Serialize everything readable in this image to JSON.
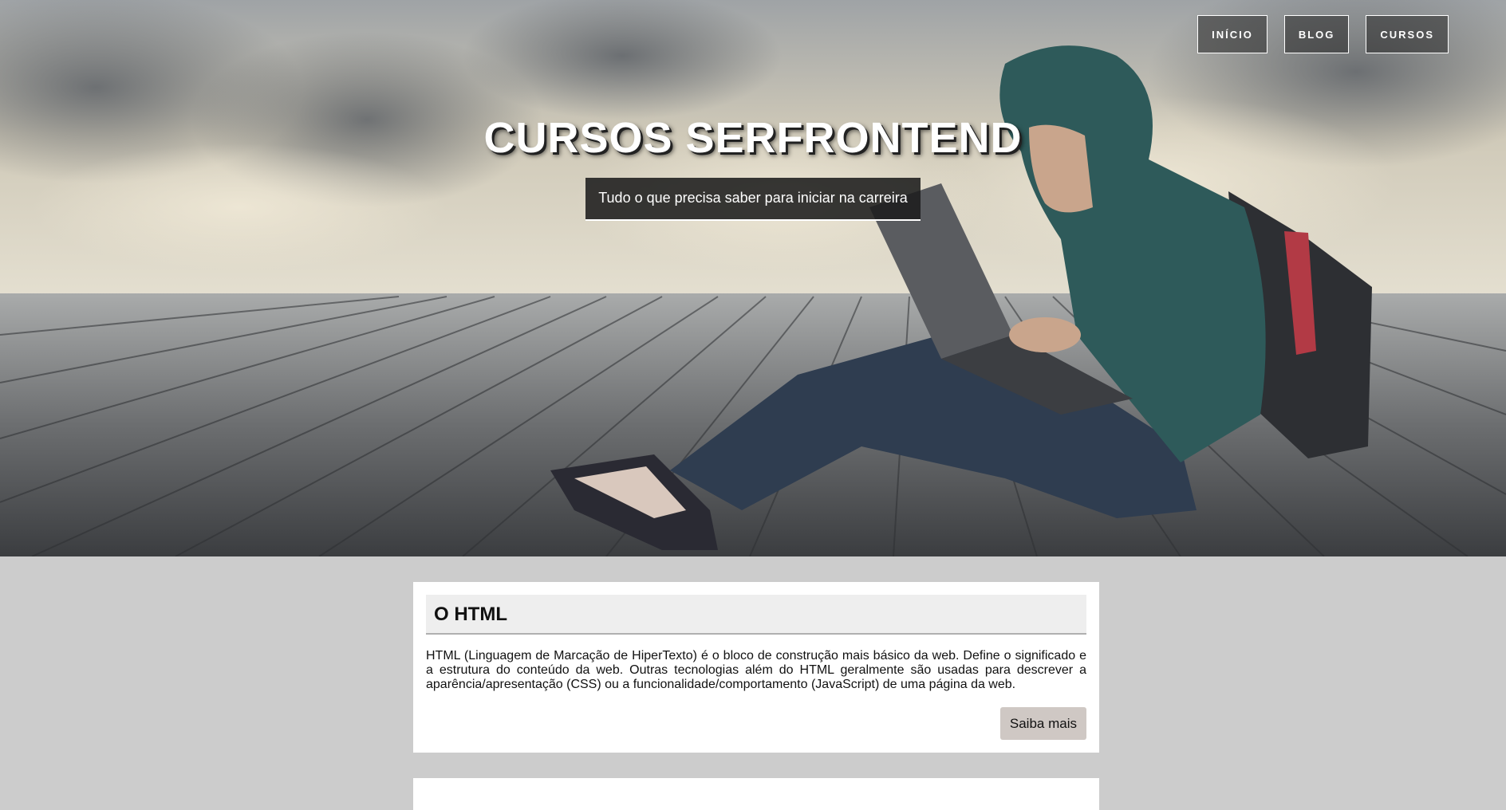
{
  "nav": {
    "items": [
      {
        "label": "INÍCIO"
      },
      {
        "label": "BLOG"
      },
      {
        "label": "CURSOS"
      }
    ]
  },
  "hero": {
    "title": "CURSOS SERFRONTEND",
    "subtitle": "Tudo o que precisa saber para iniciar na carreira",
    "image": "student-with-laptop-on-wooden-deck-photo"
  },
  "cards": [
    {
      "title": "O HTML",
      "text": "HTML (Linguagem de Marcação de HiperTexto) é o bloco de construção mais básico da web. Define o significado e a estrutura do conteúdo da web. Outras tecnologias além do HTML geralmente são usadas para descrever a aparência/apresentação (CSS) ou a funcionalidade/comportamento (JavaScript) de uma página da web.",
      "button_label": "Saiba mais"
    }
  ],
  "colors": {
    "page_background": "#cccccc",
    "card_background": "#ffffff",
    "card_header_background": "#eeeeee",
    "button_background": "#cfc8c4",
    "nav_border": "#ffffff"
  }
}
